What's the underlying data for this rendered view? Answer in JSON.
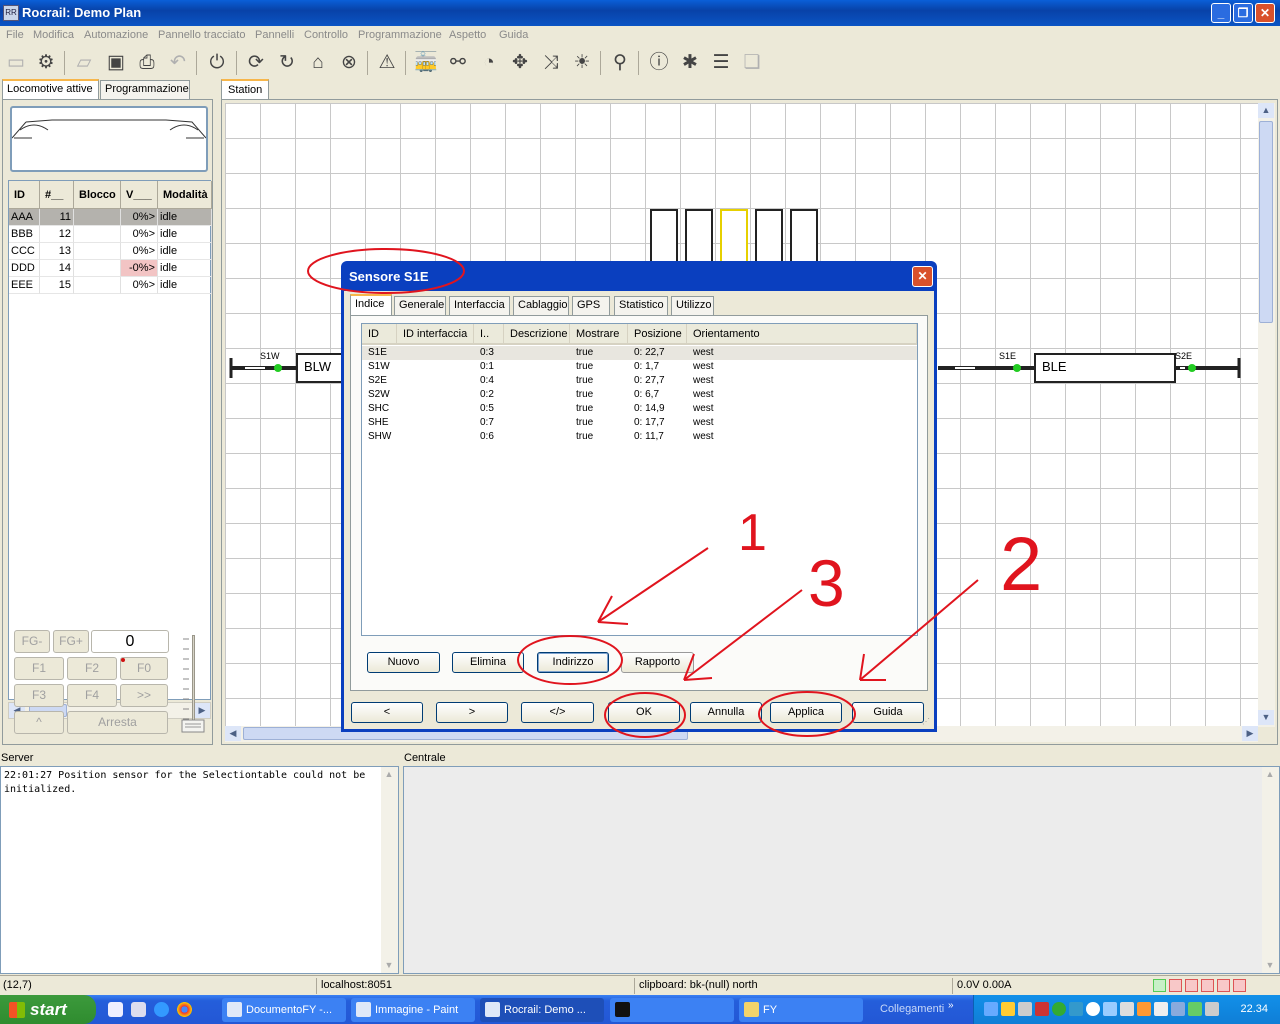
{
  "window": {
    "title": "Rocrail: Demo Plan",
    "icon_text": "RR"
  },
  "menu": [
    "File",
    "Modifica",
    "Automazione",
    "Pannello tracciato",
    "Pannelli",
    "Controllo",
    "Programmazione",
    "Aspetto",
    "Guida"
  ],
  "left_tabs": {
    "active": "Locomotive attive",
    "other": "Programmazione"
  },
  "loco_table": {
    "headers": [
      "ID",
      "#__",
      "Blocco",
      "V___",
      "Modalità"
    ],
    "rows": [
      {
        "id": "AAA",
        "num": "11",
        "block": "",
        "v": "0%>",
        "mode": "idle"
      },
      {
        "id": "BBB",
        "num": "12",
        "block": "",
        "v": "0%>",
        "mode": "idle"
      },
      {
        "id": "CCC",
        "num": "13",
        "block": "",
        "v": "0%>",
        "mode": "idle"
      },
      {
        "id": "DDD",
        "num": "14",
        "block": "",
        "v": "-0%>",
        "mode": "idle"
      },
      {
        "id": "EEE",
        "num": "15",
        "block": "",
        "v": "0%>",
        "mode": "idle"
      }
    ]
  },
  "throttle": {
    "fg_minus": "FG-",
    "fg_plus": "FG+",
    "speed": "0",
    "f1": "F1",
    "f2": "F2",
    "f0": "F0",
    "f3": "F3",
    "f4": "F4",
    "fwd": ">>",
    "up": "^",
    "stop": "Arresta"
  },
  "station": {
    "tab": "Station",
    "labels": {
      "s1w": "S1W",
      "blw": "BLW",
      "s1e": "S1E",
      "ble": "BLE",
      "s2e": "S2E"
    }
  },
  "dialog": {
    "title": "Sensore S1E",
    "tabs": [
      "Indice",
      "Generale",
      "Interfaccia",
      "Cablaggio",
      "GPS",
      "Statistico",
      "Utilizzo"
    ],
    "headers": [
      "ID",
      "ID interfaccia",
      "I..",
      "Descrizione",
      "Mostrare",
      "Posizione",
      "Orientamento"
    ],
    "rows": [
      {
        "id": "S1E",
        "iid": "",
        "addr": "0:3",
        "desc": "",
        "show": "true",
        "pos": "0: 22,7",
        "ori": "west"
      },
      {
        "id": "S1W",
        "iid": "",
        "addr": "0:1",
        "desc": "",
        "show": "true",
        "pos": "0: 1,7",
        "ori": "west"
      },
      {
        "id": "S2E",
        "iid": "",
        "addr": "0:4",
        "desc": "",
        "show": "true",
        "pos": "0: 27,7",
        "ori": "west"
      },
      {
        "id": "S2W",
        "iid": "",
        "addr": "0:2",
        "desc": "",
        "show": "true",
        "pos": "0: 6,7",
        "ori": "west"
      },
      {
        "id": "SHC",
        "iid": "",
        "addr": "0:5",
        "desc": "",
        "show": "true",
        "pos": "0: 14,9",
        "ori": "west"
      },
      {
        "id": "SHE",
        "iid": "",
        "addr": "0:7",
        "desc": "",
        "show": "true",
        "pos": "0: 17,7",
        "ori": "west"
      },
      {
        "id": "SHW",
        "iid": "",
        "addr": "0:6",
        "desc": "",
        "show": "true",
        "pos": "0: 11,7",
        "ori": "west"
      }
    ],
    "panel_buttons": {
      "new": "Nuovo",
      "delete": "Elimina",
      "address": "Indirizzo",
      "report": "Rapporto"
    },
    "footer_buttons": {
      "prev": "<",
      "next": ">",
      "xml": "</>",
      "ok": "OK",
      "cancel": "Annulla",
      "apply": "Applica",
      "help": "Guida"
    }
  },
  "annotations": {
    "n1": "1",
    "n2": "2",
    "n3": "3",
    "color": "#e0141e"
  },
  "server": {
    "label": "Server",
    "log": "22:01:27 Position sensor for the Selectiontable could not be initialized."
  },
  "centrale": {
    "label": "Centrale"
  },
  "status": {
    "coords": "(12,7)",
    "host": "localhost:8051",
    "clipboard": "clipboard: bk-(null) north",
    "power": "0.0V 0.00A"
  },
  "taskbar": {
    "start": "start",
    "tasks": [
      "DocumentoFY -...",
      "Immagine - Paint",
      "Rocrail: Demo ...",
      "",
      "FY"
    ],
    "links": "Collegamenti",
    "clock": "22.34"
  }
}
